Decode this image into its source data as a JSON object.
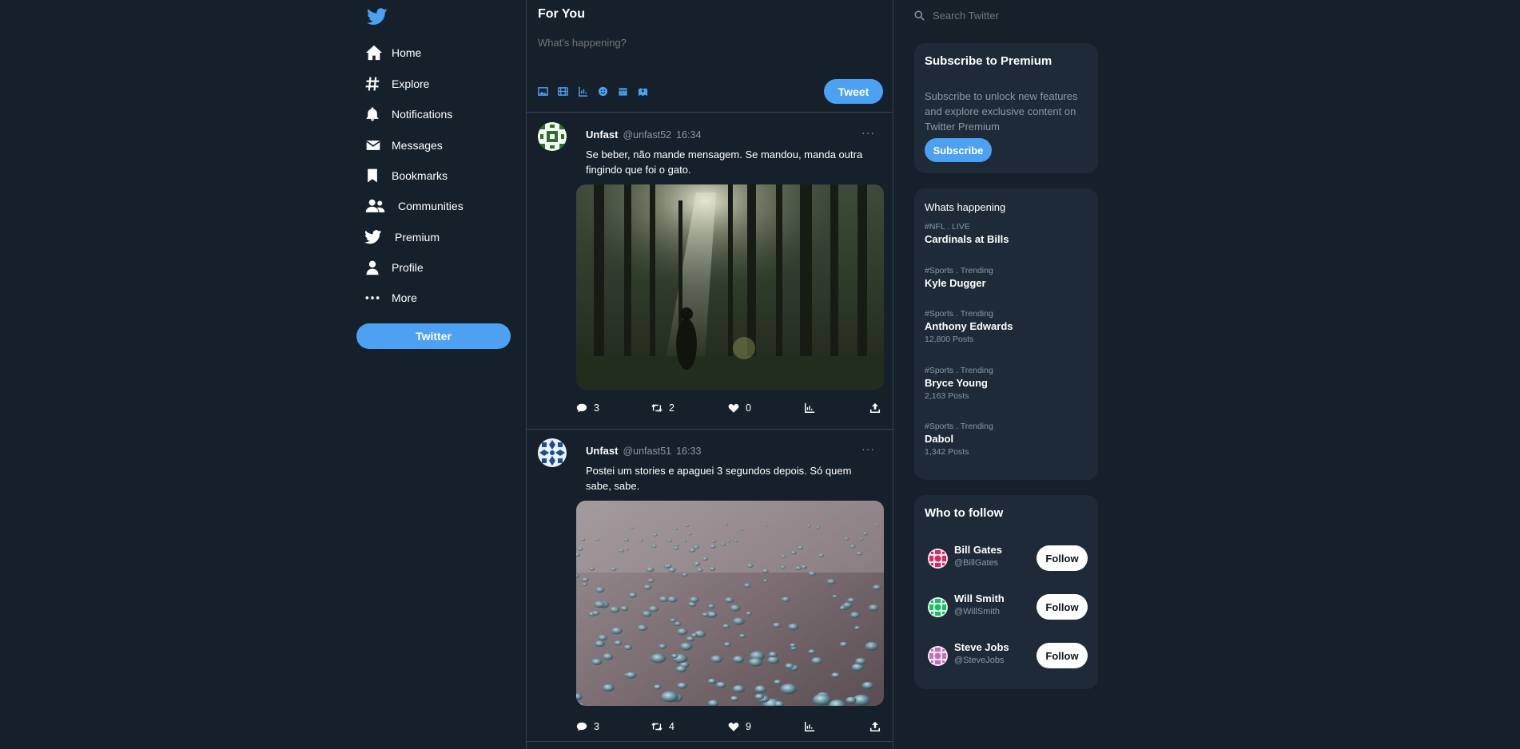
{
  "nav": {
    "items": [
      {
        "label": "Home",
        "icon": "home-icon"
      },
      {
        "label": "Explore",
        "icon": "hashtag-icon"
      },
      {
        "label": "Notifications",
        "icon": "bell-icon"
      },
      {
        "label": "Messages",
        "icon": "envelope-icon"
      },
      {
        "label": "Bookmarks",
        "icon": "bookmark-icon"
      },
      {
        "label": "Communities",
        "icon": "users-icon"
      },
      {
        "label": "Premium",
        "icon": "twitter-bird-icon"
      },
      {
        "label": "Profile",
        "icon": "user-icon"
      },
      {
        "label": "More",
        "icon": "ellipsis-icon"
      }
    ],
    "button_label": "Twitter"
  },
  "feed": {
    "title": "For You",
    "compose_placeholder": "What's happening?",
    "tweet_button": "Tweet",
    "tweets": [
      {
        "name": "Unfast",
        "handle": "@unfast52",
        "time": "16:34",
        "text": "Se beber, não mande mensagem. Se mandou, manda outra fingindo que foi o gato.",
        "image": "forest-photo",
        "replies": "3",
        "retweets": "2",
        "likes": "0"
      },
      {
        "name": "Unfast",
        "handle": "@unfast51",
        "time": "16:33",
        "text": "Postei um stories e apaguei 3 segundos depois. Só quem sabe, sabe.",
        "image": "water-droplets-photo",
        "replies": "3",
        "retweets": "4",
        "likes": "9"
      }
    ]
  },
  "search": {
    "placeholder": "Search Twitter"
  },
  "premium": {
    "title": "Subscribe to Premium",
    "description": "Subscribe to unlock new features and explore exclusive content on Twitter Premium",
    "button": "Subscribe"
  },
  "trends": {
    "title": "Whats happening",
    "items": [
      {
        "category": "#NFL . LIVE",
        "name": "Cardinals at Bills",
        "posts": ""
      },
      {
        "category": "#Sports . Trending",
        "name": "Kyle Dugger",
        "posts": ""
      },
      {
        "category": "#Sports . Trending",
        "name": "Anthony Edwards",
        "posts": "12,800 Posts"
      },
      {
        "category": "#Sports . Trending",
        "name": "Bryce Young",
        "posts": "2,163 Posts"
      },
      {
        "category": "#Sports . Trending",
        "name": "Dabol",
        "posts": "1,342 Posts"
      }
    ]
  },
  "who_to_follow": {
    "title": "Who to follow",
    "users": [
      {
        "name": "Bill Gates",
        "handle": "@BillGates",
        "button": "Follow",
        "avatar_color": "#e0245e"
      },
      {
        "name": "Will Smith",
        "handle": "@WillSmith",
        "button": "Follow",
        "avatar_color": "#17bf63"
      },
      {
        "name": "Steve Jobs",
        "handle": "@SteveJobs",
        "button": "Follow",
        "avatar_color": "#c36fc0"
      }
    ]
  },
  "colors": {
    "bg": "#15202b",
    "accent": "#4da1f2",
    "card": "#1e2a38",
    "muted": "#8899a6"
  }
}
